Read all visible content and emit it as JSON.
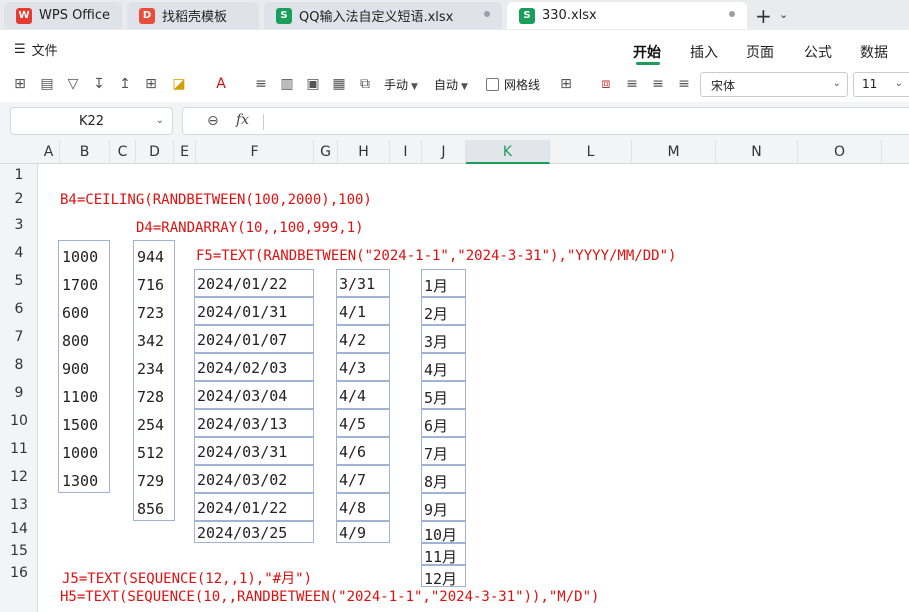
{
  "tabs": [
    {
      "label": "WPS Office",
      "icon": "wps-logo-icon",
      "icon_char": "W"
    },
    {
      "label": "找稻壳模板",
      "icon": "daoke-logo-icon",
      "icon_char": "D"
    },
    {
      "label": "QQ输入法自定义短语.xlsx",
      "icon": "sheet-file-icon",
      "icon_char": "S"
    },
    {
      "label": "330.xlsx",
      "icon": "sheet-file-icon",
      "icon_char": "S"
    }
  ],
  "menu": {
    "file_label": "文件",
    "items": [
      "开始",
      "插入",
      "页面",
      "公式",
      "数据"
    ]
  },
  "toolbar": {
    "manual_label": "手动",
    "auto_label": "自动",
    "gridline_label": "网格线",
    "font_name": "宋体",
    "font_size": "11"
  },
  "formula_bar": {
    "cell_ref": "K22",
    "fx_label": "fx"
  },
  "columns": [
    "A",
    "B",
    "C",
    "D",
    "E",
    "F",
    "G",
    "H",
    "I",
    "J",
    "K",
    "L",
    "M",
    "N",
    "O"
  ],
  "rows": [
    "1",
    "2",
    "3",
    "4",
    "5",
    "6",
    "7",
    "8",
    "9",
    "10",
    "11",
    "12",
    "13",
    "14",
    "15",
    "16"
  ],
  "annotations": {
    "b4_formula": "B4=CEILING(RANDBETWEEN(100,2000),100)",
    "d4_formula": "D4=RANDARRAY(10,,100,999,1)",
    "f5_formula": "F5=TEXT(RANDBETWEEN(\"2024-1-1\",\"2024-3-31\"),\"YYYY/MM/DD\")",
    "j5_formula": "J5=TEXT(SEQUENCE(12,,1),\"#月\")",
    "h5_formula": "H5=TEXT(SEQUENCE(10,,RANDBETWEEN(\"2024-1-1\",\"2024-3-31\")),\"M/D\")"
  },
  "col_b": [
    "1000",
    "1700",
    "600",
    "800",
    "900",
    "1100",
    "1500",
    "1000",
    "1300"
  ],
  "col_d": [
    "944",
    "716",
    "723",
    "342",
    "234",
    "728",
    "254",
    "512",
    "729",
    "856"
  ],
  "col_f": [
    "2024/01/22",
    "2024/01/31",
    "2024/01/07",
    "2024/02/03",
    "2024/03/04",
    "2024/03/13",
    "2024/03/31",
    "2024/03/02",
    "2024/01/22",
    "2024/03/25"
  ],
  "col_h": [
    "3/31",
    "4/1",
    "4/2",
    "4/3",
    "4/4",
    "4/5",
    "4/6",
    "4/7",
    "4/8",
    "4/9"
  ],
  "col_j": [
    "1月",
    "2月",
    "3月",
    "4月",
    "5月",
    "6月",
    "7月",
    "8月",
    "9月",
    "10月",
    "11月",
    "12月"
  ],
  "colors": {
    "accent": "#1a9e5c",
    "formula_text": "#e01010",
    "cell_border": "#9fb3d6"
  }
}
